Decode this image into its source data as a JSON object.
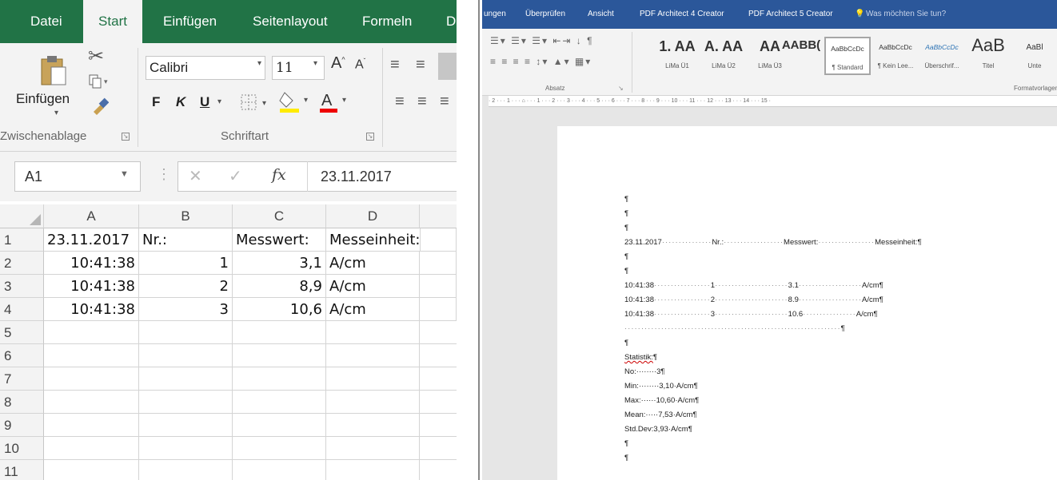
{
  "excel": {
    "tabs": [
      "Datei",
      "Start",
      "Einfügen",
      "Seitenlayout",
      "Formeln",
      "D"
    ],
    "active_tab": "Start",
    "clipboard": {
      "paste_label": "Einfügen",
      "group_label": "Zwischenablage"
    },
    "font": {
      "name": "Calibri",
      "size": "11",
      "bold": "F",
      "italic": "K",
      "underline": "U",
      "group_label": "Schriftart"
    },
    "name_box": "A1",
    "formula_value": "23.11.2017",
    "fx": "fx",
    "columns": [
      "A",
      "B",
      "C",
      "D"
    ],
    "rows": [
      {
        "num": "1",
        "a": "23.11.2017",
        "b": "Nr.:",
        "c": "Messwert:",
        "d": "Messeinheit:"
      },
      {
        "num": "2",
        "a": "10:41:38",
        "b": "1",
        "c": "3,1",
        "d": "A/cm"
      },
      {
        "num": "3",
        "a": "10:41:38",
        "b": "2",
        "c": "8,9",
        "d": "A/cm"
      },
      {
        "num": "4",
        "a": "10:41:38",
        "b": "3",
        "c": "10,6",
        "d": "A/cm"
      },
      {
        "num": "5",
        "a": "",
        "b": "",
        "c": "",
        "d": ""
      },
      {
        "num": "6",
        "a": "",
        "b": "",
        "c": "",
        "d": ""
      },
      {
        "num": "7",
        "a": "",
        "b": "",
        "c": "",
        "d": ""
      },
      {
        "num": "8",
        "a": "",
        "b": "",
        "c": "",
        "d": ""
      },
      {
        "num": "9",
        "a": "",
        "b": "",
        "c": "",
        "d": ""
      },
      {
        "num": "10",
        "a": "",
        "b": "",
        "c": "",
        "d": ""
      },
      {
        "num": "11",
        "a": "",
        "b": "",
        "c": "",
        "d": ""
      }
    ]
  },
  "word": {
    "tabs": [
      "ungen",
      "Überprüfen",
      "Ansicht",
      "PDF Architect 4 Creator",
      "PDF Architect 5 Creator",
      "Was möchten Sie tun?"
    ],
    "absatz_label": "Absatz",
    "formatvorlagen_label": "Formatvorlagen",
    "styles": [
      {
        "sample": "1. AA",
        "name": "LiMa Ü1"
      },
      {
        "sample": "A. AA",
        "name": "LiMa Ü2"
      },
      {
        "sample": "AA",
        "name": "LiMa Ü3"
      },
      {
        "sample": "AABB(",
        "name": ""
      },
      {
        "sample": "AaBbCcDc",
        "name": "¶ Standard"
      },
      {
        "sample": "AaBbCcDc",
        "name": "¶ Kein Lee..."
      },
      {
        "sample": "AaBbCcDc",
        "name": "Überschrif..."
      },
      {
        "sample": "AaB",
        "name": "Titel"
      },
      {
        "sample": "AaBl",
        "name": "Unte"
      }
    ],
    "ruler": "· 2 · · · 1 · · · ⌂ · · · 1 · · · 2 · · · 3 · · · 4 · · · 5 · · · 6 · · · 7 · · · 8 · · · 9 · · · 10 · · · 11 · · · 12 · · · 13 · · · 14 · · · 15 ·",
    "pilcrow": "¶",
    "header_line": {
      "date": "23.11.2017",
      "nr": "Nr.:",
      "messwert": "Messwert:",
      "messeinheit": "Messeinheit:"
    },
    "data_lines": [
      {
        "time": "10:41:38",
        "nr": "1",
        "val": "3.1",
        "unit": "A/cm"
      },
      {
        "time": "10:41:38",
        "nr": "2",
        "val": "8.9",
        "unit": "A/cm"
      },
      {
        "time": "10:41:38",
        "nr": "3",
        "val": "10.6",
        "unit": "A/cm"
      }
    ],
    "stats": {
      "title": "Statistik:",
      "no": "No:········3",
      "min": "Min:········3,10·A/cm",
      "max": "Max:······10,60·A/cm",
      "mean": "Mean:·····7,53·A/cm",
      "std": "Std.Dev:3,93·A/cm"
    }
  }
}
